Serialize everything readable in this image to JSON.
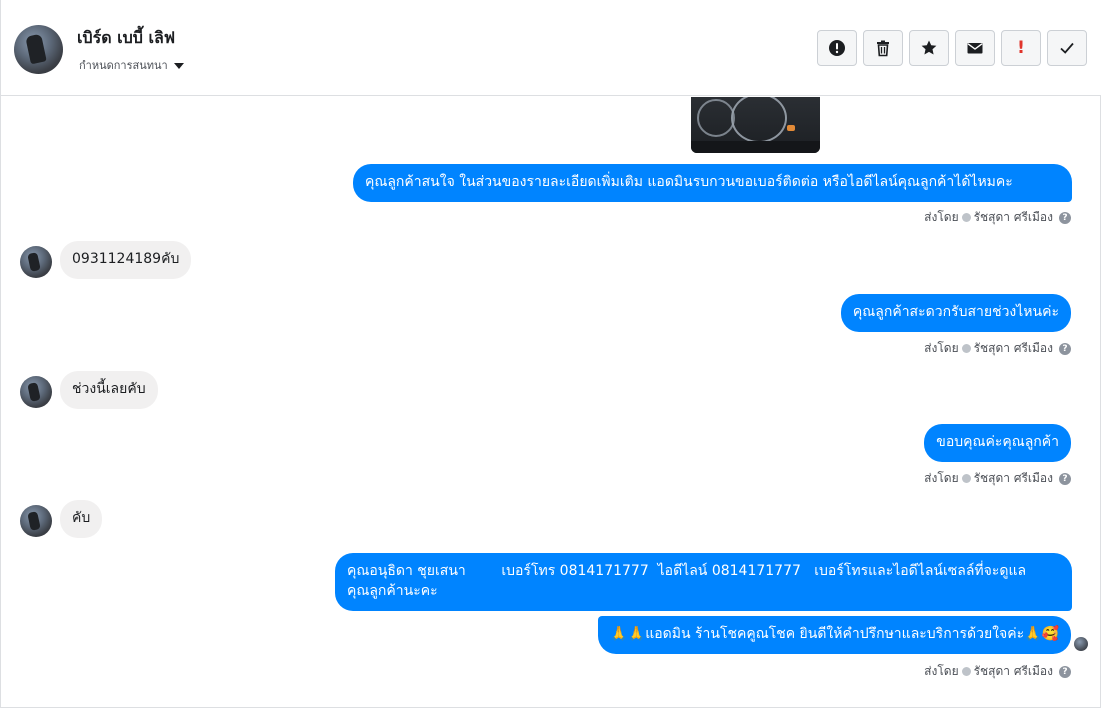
{
  "header": {
    "name": "เบิร์ด เบบี้ เลิฟ",
    "assign_label": "กำหนดการสนทนา",
    "toolbar": [
      {
        "icon": "alert-circle-icon",
        "label": "!"
      },
      {
        "icon": "trash-icon",
        "label": ""
      },
      {
        "icon": "star-icon",
        "label": ""
      },
      {
        "icon": "envelope-icon",
        "label": ""
      },
      {
        "icon": "spam-icon",
        "label": "!"
      },
      {
        "icon": "check-icon",
        "label": ""
      }
    ]
  },
  "messages": [
    {
      "dir": "out",
      "text": "คุณลูกค้าสนใจ ในส่วนของรายละเอียดเพิ่มเติม แอดมินรบกวนขอเบอร์ติดต่อ หรือไอดีไลน์คุณลูกค้าได้ไหมคะ"
    },
    {
      "dir": "in",
      "text": "0931124189คับ"
    },
    {
      "dir": "out",
      "text": "คุณลูกค้าสะดวกรับสายช่วงไหนค่ะ"
    },
    {
      "dir": "in",
      "text": "ช่วงนี้เลยคับ"
    },
    {
      "dir": "out",
      "text": "ขอบคุณค่ะคุณลูกค้า"
    },
    {
      "dir": "in",
      "text": "คับ"
    },
    {
      "dir": "out",
      "text_line1": "คุณอนุธิดา ชุยเสนา        เบอร์โทร 0814171777  ไอดีไลน์ 0814171777   เบอร์โทรและไอดีไลน์เซลล์ที่จะดูแล",
      "text_line2": "คุณลูกค้านะคะ"
    },
    {
      "dir": "out",
      "text": "🙏🙏แอดมิน ร้านโชคคูณโชค ยินดีให้คำปรึกษาและบริการด้วยใจค่ะ🙏🥰"
    }
  ],
  "meta": {
    "sent_by": "ส่งโดย",
    "agent": "รัชสุดา ศรีเมือง",
    "help": "?"
  }
}
